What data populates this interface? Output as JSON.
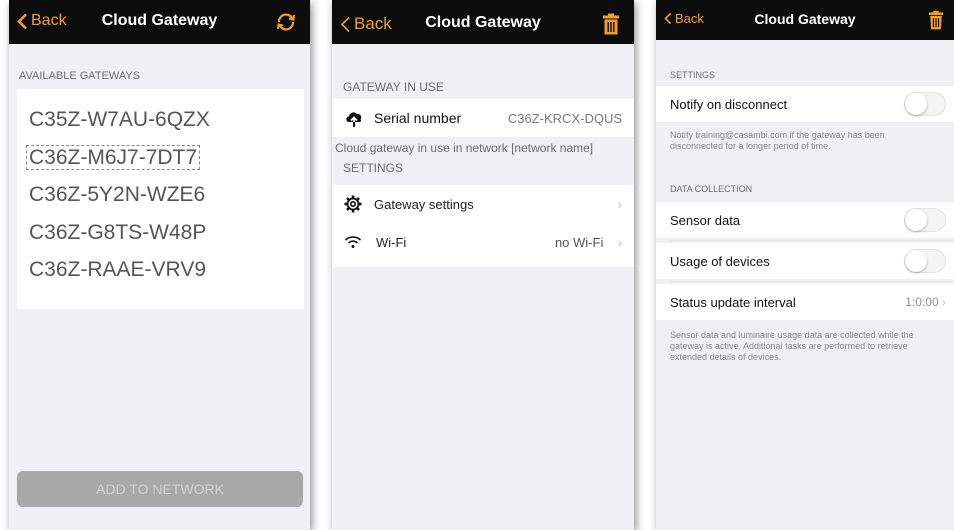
{
  "screen1": {
    "back_label": "Back",
    "title": "Cloud Gateway",
    "section_header": "AVAILABLE GATEWAYS",
    "gateways": [
      "C35Z-W7AU-6QZX",
      "C36Z-M6J7-7DT7",
      "C36Z-5Y2N-WZE6",
      "C36Z-G8TS-W48P",
      "C36Z-RAAE-VRV9"
    ],
    "selected_index": 1,
    "add_button": "ADD TO NETWORK",
    "right_icon": "refresh-icon"
  },
  "screen2": {
    "back_label": "Back",
    "title": "Cloud Gateway",
    "right_icon": "trash-icon",
    "section_in_use": "GATEWAY IN USE",
    "serial_label": "Serial number",
    "serial_value": "C36Z-KRCX-DQUS",
    "info_text": "Cloud gateway in use in network [network name]",
    "section_settings": "SETTINGS",
    "gateway_settings_label": "Gateway settings",
    "wifi_label": "Wi-Fi",
    "wifi_value": "no Wi-Fi"
  },
  "screen3": {
    "back_label": "Back",
    "title": "Cloud Gateway",
    "right_icon": "trash-icon",
    "section_settings": "SETTINGS",
    "notify_label": "Notify on disconnect",
    "notify_on": false,
    "notify_note": "Notify training@casambi.com if the gateway has been disconnected for a longer period of time.",
    "section_data": "DATA COLLECTION",
    "sensor_label": "Sensor data",
    "sensor_on": false,
    "usage_label": "Usage of devices",
    "usage_on": false,
    "interval_label": "Status update interval",
    "interval_value": "1:0:00",
    "data_note": "Sensor data and luminaire usage data are collected while the gateway is active. Additional tasks are performed to retrieve extended details of devices."
  },
  "colors": {
    "accent": "#f0a023",
    "navbar": "#0c0c0c",
    "background": "#efeff4"
  }
}
